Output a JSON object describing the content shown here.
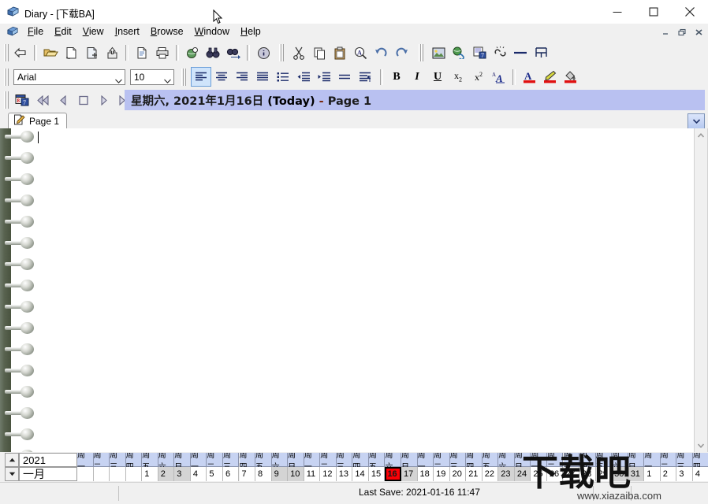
{
  "window": {
    "title": "Diary - [下载BA]",
    "icon": "diary-book-icon",
    "minimize": "−",
    "maximize": "□",
    "close": "✕"
  },
  "mdi_controls": {
    "minimize": "_",
    "restore": "❐",
    "close": "✖"
  },
  "menu": {
    "items": [
      {
        "label": "File",
        "accel": "F"
      },
      {
        "label": "Edit",
        "accel": "E"
      },
      {
        "label": "View",
        "accel": "V"
      },
      {
        "label": "Insert",
        "accel": "I"
      },
      {
        "label": "Browse",
        "accel": "B"
      },
      {
        "label": "Window",
        "accel": "W"
      },
      {
        "label": "Help",
        "accel": "H"
      }
    ]
  },
  "toolbar_main": {
    "buttons": [
      {
        "name": "back-icon",
        "group": 0
      },
      {
        "name": "open-folder-icon",
        "group": 1
      },
      {
        "name": "new-page-icon",
        "group": 1
      },
      {
        "name": "add-page-icon",
        "group": 1
      },
      {
        "name": "export-icon",
        "group": 1
      },
      {
        "name": "print-preview-icon",
        "group": 2
      },
      {
        "name": "print-icon",
        "group": 2
      },
      {
        "name": "search-globe-icon",
        "group": 3
      },
      {
        "name": "binoculars-icon",
        "group": 3
      },
      {
        "name": "find-next-icon",
        "group": 3
      },
      {
        "name": "info-icon",
        "group": 4
      }
    ],
    "buttons2": [
      {
        "name": "cut-icon"
      },
      {
        "name": "copy-icon"
      },
      {
        "name": "paste-icon"
      },
      {
        "name": "find-replace-icon"
      },
      {
        "name": "undo-icon"
      },
      {
        "name": "redo-icon"
      }
    ],
    "buttons3": [
      {
        "name": "insert-image-icon"
      },
      {
        "name": "insert-link-icon"
      },
      {
        "name": "insert-note-icon"
      },
      {
        "name": "remove-link-icon"
      },
      {
        "name": "horizontal-rule-icon"
      },
      {
        "name": "insert-table-icon"
      }
    ]
  },
  "toolbar_format": {
    "font_name": "Arial",
    "font_size": "10",
    "align": [
      {
        "name": "align-left-button",
        "active": true
      },
      {
        "name": "align-center-button",
        "active": false
      },
      {
        "name": "align-right-button",
        "active": false
      },
      {
        "name": "align-justify-button",
        "active": false
      },
      {
        "name": "bullet-list-button",
        "active": false
      },
      {
        "name": "decrease-indent-button",
        "active": false
      },
      {
        "name": "increase-indent-button",
        "active": false
      },
      {
        "name": "line-spacing-button",
        "active": false
      },
      {
        "name": "paragraph-button",
        "active": false
      }
    ],
    "styles": [
      {
        "name": "bold-button",
        "label": "B"
      },
      {
        "name": "italic-button",
        "label": "I"
      },
      {
        "name": "underline-button",
        "label": "U"
      },
      {
        "name": "subscript-button",
        "label": "x₂"
      },
      {
        "name": "superscript-button",
        "label": "x²"
      },
      {
        "name": "font-style-button",
        "label": "A"
      }
    ],
    "colors": [
      {
        "name": "font-color-button",
        "glyph": "A",
        "swatch": "#e01010"
      },
      {
        "name": "highlight-color-button",
        "glyph": "pen",
        "swatch": "#e01010"
      },
      {
        "name": "fill-color-button",
        "glyph": "bucket",
        "swatch": "#e01010"
      }
    ]
  },
  "datebar": {
    "calendar_icon": "calendar-icon",
    "nav": [
      {
        "name": "first-page-button",
        "glyph": "first"
      },
      {
        "name": "previous-page-button",
        "glyph": "prev"
      },
      {
        "name": "today-button",
        "glyph": "square"
      },
      {
        "name": "next-page-button",
        "glyph": "next"
      },
      {
        "name": "last-page-button",
        "glyph": "last"
      }
    ],
    "date_cn": "星期六, 2021年1月16日",
    "today_label": "(Today)",
    "separator": "-",
    "page_label": "Page 1",
    "band_color": "#b9c1f1"
  },
  "tabs": {
    "items": [
      {
        "label": "Page 1",
        "icon": "page-edit-icon",
        "active": true
      }
    ],
    "dropdown_icon": "chevron-down-icon"
  },
  "editor": {
    "content": "",
    "caret_visible": true,
    "scroll_up_icon": "chevron-up-icon",
    "scroll_down_icon": "chevron-down-icon"
  },
  "calendar": {
    "year": "2021",
    "month": "一月",
    "spin_up": "▲",
    "spin_down": "▼",
    "today_day": 16,
    "today_color": "#fb0006",
    "days": [
      {
        "dow": "周一",
        "num": "",
        "weekend": false
      },
      {
        "dow": "周二",
        "num": "",
        "weekend": false
      },
      {
        "dow": "周三",
        "num": "",
        "weekend": false
      },
      {
        "dow": "周四",
        "num": "",
        "weekend": false
      },
      {
        "dow": "周五",
        "num": "1",
        "weekend": false
      },
      {
        "dow": "周六",
        "num": "2",
        "weekend": true
      },
      {
        "dow": "周日",
        "num": "3",
        "weekend": true
      },
      {
        "dow": "周一",
        "num": "4",
        "weekend": false
      },
      {
        "dow": "周二",
        "num": "5",
        "weekend": false
      },
      {
        "dow": "周三",
        "num": "6",
        "weekend": false
      },
      {
        "dow": "周四",
        "num": "7",
        "weekend": false
      },
      {
        "dow": "周五",
        "num": "8",
        "weekend": false
      },
      {
        "dow": "周六",
        "num": "9",
        "weekend": true
      },
      {
        "dow": "周日",
        "num": "10",
        "weekend": true
      },
      {
        "dow": "周一",
        "num": "11",
        "weekend": false
      },
      {
        "dow": "周二",
        "num": "12",
        "weekend": false
      },
      {
        "dow": "周三",
        "num": "13",
        "weekend": false
      },
      {
        "dow": "周四",
        "num": "14",
        "weekend": false
      },
      {
        "dow": "周五",
        "num": "15",
        "weekend": false
      },
      {
        "dow": "周六",
        "num": "16",
        "weekend": true,
        "today": true
      },
      {
        "dow": "周日",
        "num": "17",
        "weekend": true
      },
      {
        "dow": "周一",
        "num": "18",
        "weekend": false
      },
      {
        "dow": "周二",
        "num": "19",
        "weekend": false
      },
      {
        "dow": "周三",
        "num": "20",
        "weekend": false
      },
      {
        "dow": "周四",
        "num": "21",
        "weekend": false
      },
      {
        "dow": "周五",
        "num": "22",
        "weekend": false
      },
      {
        "dow": "周六",
        "num": "23",
        "weekend": true
      },
      {
        "dow": "周日",
        "num": "24",
        "weekend": true
      },
      {
        "dow": "周一",
        "num": "25",
        "weekend": false
      },
      {
        "dow": "周二",
        "num": "26",
        "weekend": false
      },
      {
        "dow": "周三",
        "num": "27",
        "weekend": false
      },
      {
        "dow": "周四",
        "num": "28",
        "weekend": false
      },
      {
        "dow": "周五",
        "num": "29",
        "weekend": false
      },
      {
        "dow": "周六",
        "num": "30",
        "weekend": true
      },
      {
        "dow": "周日",
        "num": "31",
        "weekend": true
      },
      {
        "dow": "周一",
        "num": "1",
        "weekend": false
      },
      {
        "dow": "周二",
        "num": "2",
        "weekend": false
      },
      {
        "dow": "周三",
        "num": "3",
        "weekend": false
      },
      {
        "dow": "周四",
        "num": "4",
        "weekend": false
      }
    ]
  },
  "statusbar": {
    "last_save": "Last Save: 2021-01-16 11:47"
  },
  "watermark": {
    "text_cn": "下载吧",
    "url": "www.xiazaiba.com"
  }
}
